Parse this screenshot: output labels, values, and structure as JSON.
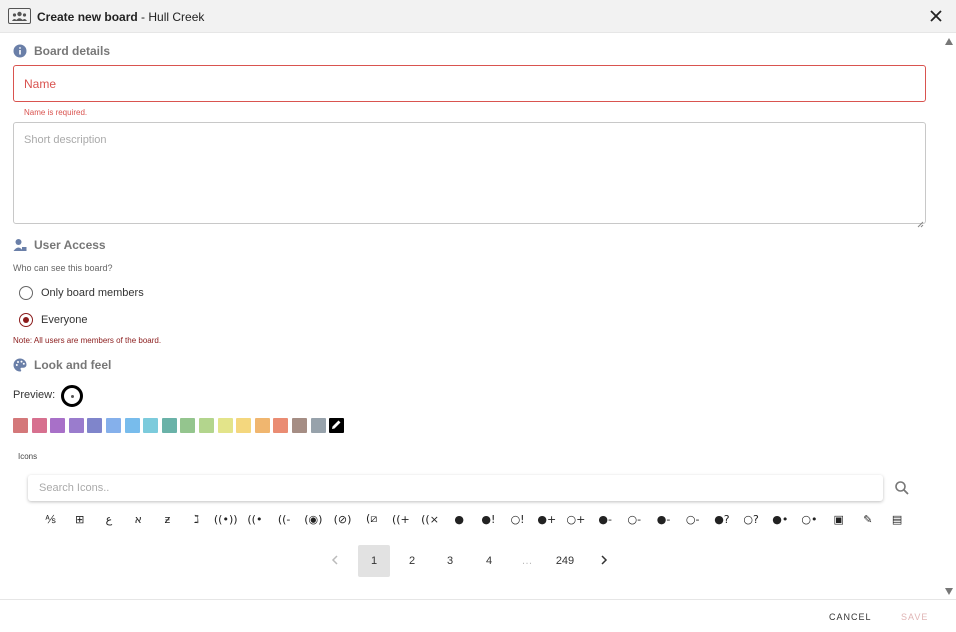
{
  "header": {
    "title_bold": "Create new board",
    "title_rest": " - Hull Creek",
    "board_icon": "board-group-icon",
    "close_icon": "close-icon"
  },
  "board_details": {
    "heading": "Board details",
    "name_placeholder": "Name",
    "name_value": "",
    "name_error": "Name is required.",
    "description_placeholder": "Short description",
    "description_value": ""
  },
  "user_access": {
    "heading": "User Access",
    "question": "Who can see this board?",
    "options": [
      {
        "label": "Only board members",
        "selected": false
      },
      {
        "label": "Everyone",
        "selected": true
      }
    ],
    "note": "Note: All users are members of the board."
  },
  "look_and_feel": {
    "heading": "Look and feel",
    "preview_label": "Preview:",
    "swatch_colors": [
      "#d4787a",
      "#d7708f",
      "#a870c8",
      "#9a7ccd",
      "#7f85cb",
      "#85b0eb",
      "#78bcec",
      "#7ccbdc",
      "#6ab2a8",
      "#94c58e",
      "#b3d58d",
      "#e3e48a",
      "#f4d77e",
      "#f0b66f",
      "#ea8c73",
      "#a58d84",
      "#97a2ab"
    ],
    "swatch_picker_icon": "pencil-icon",
    "icons_label": "Icons",
    "search_placeholder": "Search Icons..",
    "search_icon": "search-icon",
    "icon_glyphs": [
      "⅍",
      "⊞",
      "ع",
      "א",
      "ƶ",
      "ℷ",
      "((•))",
      "((•",
      "((-",
      "(◉)",
      "(⊘)",
      "(⧄",
      "((+",
      "((×",
      "●",
      "●!",
      "○!",
      "●+",
      "○+",
      "●-",
      "○-",
      "●-",
      "○-",
      "●?",
      "○?",
      "●•",
      "○•",
      "▣",
      "✎",
      "▤"
    ]
  },
  "pagination": {
    "prev_icon": "chevron-left-icon",
    "pages": [
      "1",
      "2",
      "3",
      "4"
    ],
    "ellipsis": "…",
    "last_page": "249",
    "next_icon": "chevron-right-icon",
    "current_page": 1
  },
  "footer": {
    "cancel_label": "CANCEL",
    "save_label": "SAVE"
  }
}
